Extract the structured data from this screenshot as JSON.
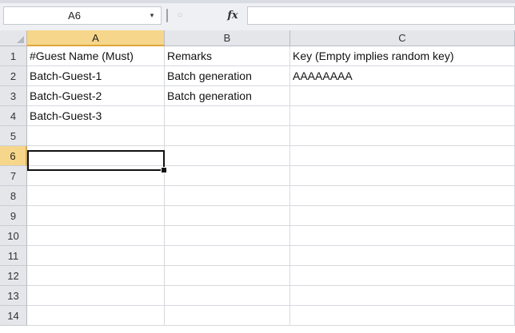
{
  "formula_bar": {
    "name_box": "A6",
    "name_box_dropdown_icon": "▾",
    "cancel_icon": "○",
    "fx_icon": "fx",
    "formula_value": ""
  },
  "grid": {
    "columns": [
      "A",
      "B",
      "C"
    ],
    "rows": [
      "1",
      "2",
      "3",
      "4",
      "5",
      "6",
      "7",
      "8",
      "9",
      "10",
      "11",
      "12",
      "13",
      "14"
    ],
    "active_column": "A",
    "active_row": "6",
    "cells": [
      [
        "#Guest Name (Must)",
        "Remarks",
        "Key (Empty implies random key)"
      ],
      [
        "Batch-Guest-1",
        "Batch generation",
        "AAAAAAAA"
      ],
      [
        "Batch-Guest-2",
        "Batch generation",
        ""
      ],
      [
        "Batch-Guest-3",
        "",
        ""
      ],
      [
        "",
        "",
        ""
      ],
      [
        "",
        "",
        ""
      ],
      [
        "",
        "",
        ""
      ],
      [
        "",
        "",
        ""
      ],
      [
        "",
        "",
        ""
      ],
      [
        "",
        "",
        ""
      ],
      [
        "",
        "",
        ""
      ],
      [
        "",
        "",
        ""
      ],
      [
        "",
        "",
        ""
      ],
      [
        "",
        "",
        ""
      ]
    ]
  }
}
